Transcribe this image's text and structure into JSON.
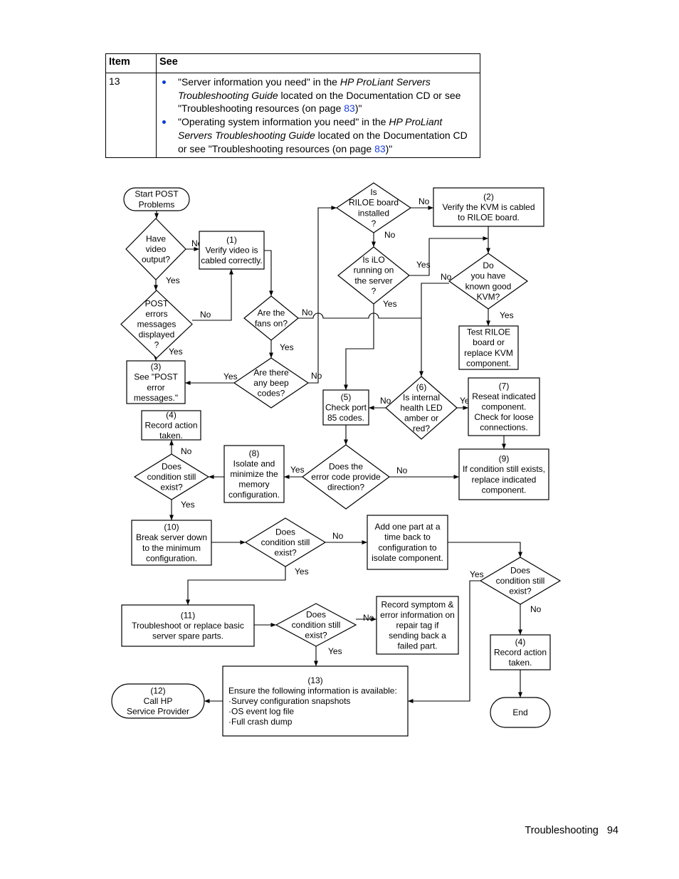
{
  "table": {
    "headers": [
      "Item",
      "See"
    ],
    "rows": [
      {
        "item": "13",
        "bullets": [
          {
            "pre": "\"Server information you need\" in the ",
            "italic1": "HP ProLiant Servers Troubleshooting Guide",
            "mid": " located on the Documentation CD or see \"Troubleshooting resources (on page ",
            "link": "83",
            "post": ")\""
          },
          {
            "pre": "\"Operating system information you need\" in the ",
            "italic1": "HP ProLiant Servers Troubleshooting Guide",
            "mid": " located on the Documentation CD or see \"Troubleshooting resources (on page ",
            "link": "83",
            "post": ")\""
          }
        ]
      }
    ]
  },
  "flowchart": {
    "nodes": {
      "start": [
        "Start POST",
        "Problems"
      ],
      "d_video": [
        "Have",
        "video",
        "output?"
      ],
      "b1": [
        "(1)",
        "Verify video is",
        "cabled correctly."
      ],
      "d_post": [
        "POST",
        "errors",
        "messages",
        "displayed",
        "?"
      ],
      "b3": [
        "(3)",
        "See \"POST",
        "error",
        "messages.\""
      ],
      "b4a": [
        "(4)",
        "Record action",
        "taken."
      ],
      "d_fans": [
        "Are the",
        "fans on?"
      ],
      "d_beep": [
        "Are there",
        "any beep",
        "codes?"
      ],
      "d_riloe": [
        "Is",
        "RILOE board",
        "installed",
        "?"
      ],
      "b2": [
        "(2)",
        "Verify the KVM is cabled",
        "to RILOE board."
      ],
      "d_ilo": [
        "Is iLO",
        "running on",
        "the server",
        "?"
      ],
      "d_kvm": [
        "Do",
        "you have",
        "known good",
        "KVM?"
      ],
      "b_test": [
        "Test RILOE",
        "board or",
        "replace KVM",
        "component."
      ],
      "b5": [
        "(5)",
        "Check port",
        "85 codes."
      ],
      "d_led": [
        "(6)",
        "Is internal",
        "health LED",
        "amber or",
        "red?"
      ],
      "b7": [
        "(7)",
        "Reseat indicated",
        "component.",
        "Check for loose",
        "connections."
      ],
      "d_err": [
        "Does the",
        "error code provide",
        "direction?"
      ],
      "b8": [
        "(8)",
        "Isolate and",
        "minimize the",
        "memory",
        "configuration."
      ],
      "d_cond1": [
        "Does",
        "condition still",
        "exist?"
      ],
      "b9": [
        "(9)",
        "If condition still exists,",
        "replace indicated",
        "component."
      ],
      "b10": [
        "(10)",
        "Break server down",
        "to the minimum",
        "configuration."
      ],
      "d_cond2": [
        "Does",
        "condition still",
        "exist?"
      ],
      "b_add": [
        "Add one part at a",
        "time back to",
        "configuration to",
        "isolate component."
      ],
      "d_cond3": [
        "Does",
        "condition still",
        "exist?"
      ],
      "b11": [
        "(11)",
        "Troubleshoot or replace basic",
        "server spare parts."
      ],
      "d_cond4": [
        "Does",
        "condition still",
        "exist?"
      ],
      "b_rec": [
        "Record symptom &",
        "error information on",
        "repair tag if",
        "sending back a",
        "failed part."
      ],
      "b4b": [
        "(4)",
        "Record action",
        "taken."
      ],
      "b13": [
        "(13)",
        "Ensure the following information is available:",
        "·Survey configuration snapshots",
        "·OS event log file",
        "·Full crash dump"
      ],
      "b12": [
        "(12)",
        "Call HP",
        "Service Provider"
      ],
      "end": [
        "End"
      ]
    },
    "edge_labels": [
      "No",
      "Yes",
      "No",
      "Yes",
      "No",
      "Yes",
      "No",
      "Yes",
      "No",
      "Yes",
      "No",
      "No",
      "Yes",
      "Yes",
      "No",
      "Yes",
      "No",
      "Yes",
      "No",
      "Yes",
      "No",
      "Yes",
      "Yes",
      "No",
      "No",
      "Yes"
    ]
  },
  "footer": {
    "section": "Troubleshooting",
    "page": "94"
  }
}
